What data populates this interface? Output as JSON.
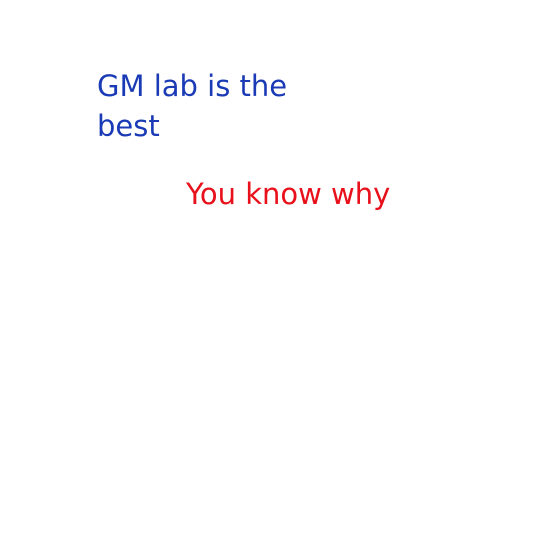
{
  "headline": {
    "line1": "GM lab is the",
    "line2": "best",
    "color": "#1a3bb5"
  },
  "subline": {
    "text": "You know why",
    "color": "#e8101a"
  }
}
